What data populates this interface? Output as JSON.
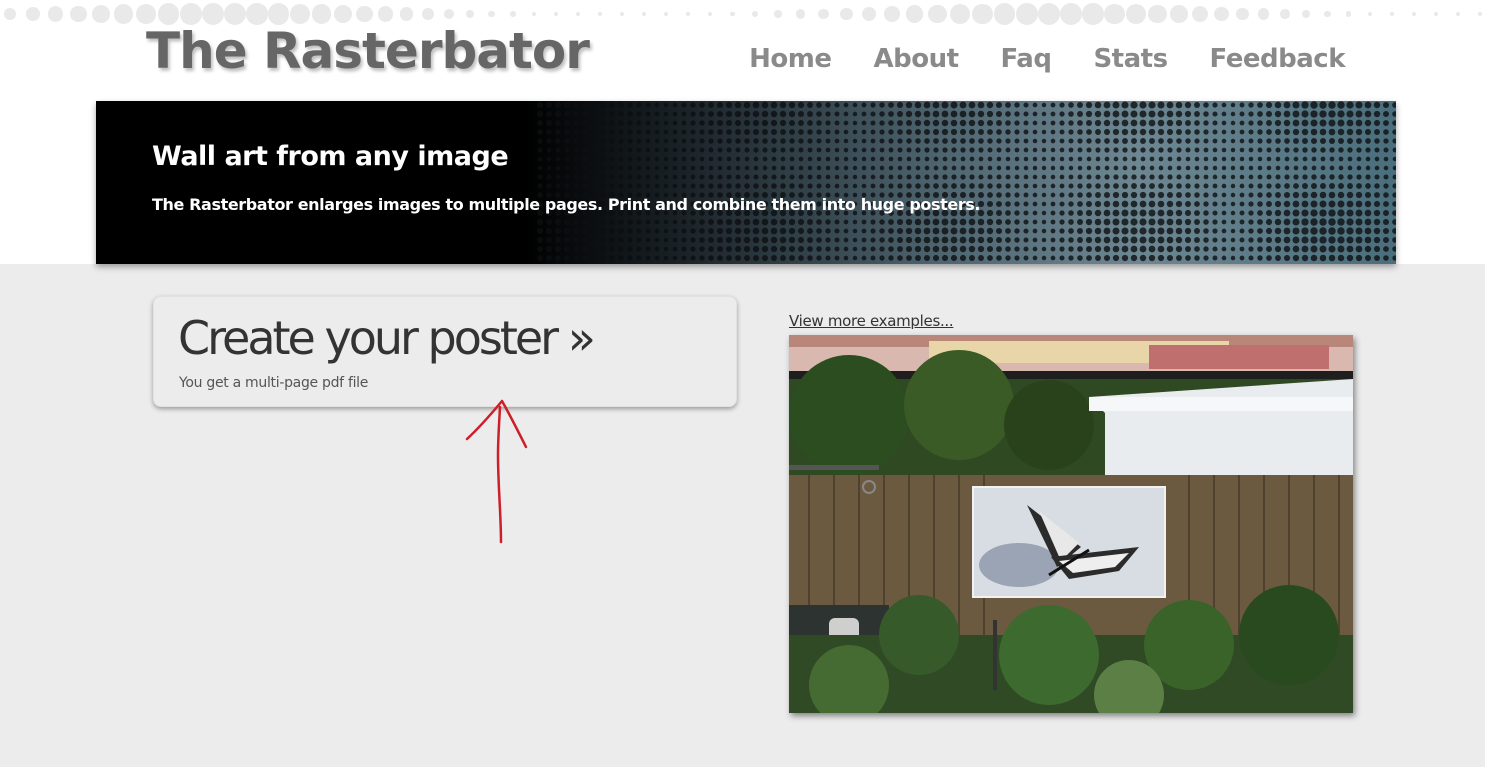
{
  "site": {
    "logo": "The Rasterbator"
  },
  "nav": {
    "items": [
      {
        "label": "Home"
      },
      {
        "label": "About"
      },
      {
        "label": "Faq"
      },
      {
        "label": "Stats"
      },
      {
        "label": "Feedback"
      }
    ]
  },
  "banner": {
    "title": "Wall art from any image",
    "subtitle": "The Rasterbator enlarges images to multiple pages. Print and combine them into huge posters."
  },
  "create": {
    "title": "Create your poster »",
    "subtitle": "You get a multi-page pdf file"
  },
  "examples": {
    "link": "View more examples..."
  },
  "colors": {
    "background": "#ececec",
    "nav_text": "#8a8a8a",
    "logo_text": "#666666",
    "annotation_arrow": "#cc1f2a"
  },
  "icons": {
    "annotation": "hand-drawn-arrow-up"
  }
}
